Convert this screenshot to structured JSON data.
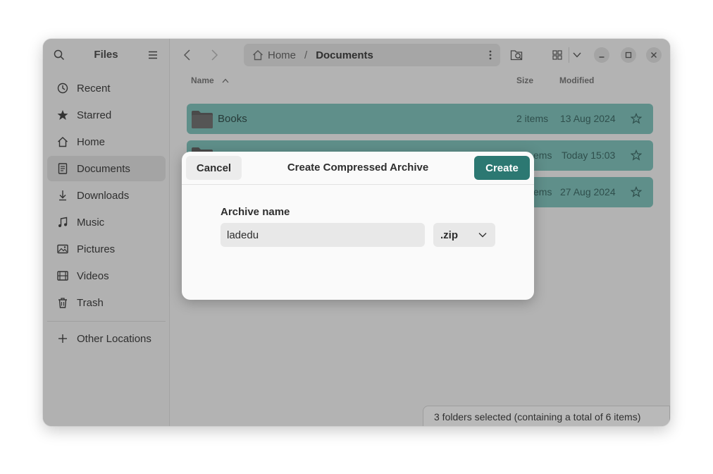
{
  "sidebar": {
    "title": "Files",
    "items": [
      {
        "label": "Recent",
        "icon": "clock-icon"
      },
      {
        "label": "Starred",
        "icon": "star-icon"
      },
      {
        "label": "Home",
        "icon": "home-icon"
      },
      {
        "label": "Documents",
        "icon": "document-icon",
        "active": true
      },
      {
        "label": "Downloads",
        "icon": "download-icon"
      },
      {
        "label": "Music",
        "icon": "music-icon"
      },
      {
        "label": "Pictures",
        "icon": "image-icon"
      },
      {
        "label": "Videos",
        "icon": "film-icon"
      },
      {
        "label": "Trash",
        "icon": "trash-icon"
      }
    ],
    "other_locations": "Other Locations"
  },
  "pathbar": {
    "home": "Home",
    "separator": "/",
    "current": "Documents"
  },
  "columns": {
    "name": "Name",
    "size": "Size",
    "modified": "Modified"
  },
  "rows": [
    {
      "name": "Books",
      "size": "2 items",
      "modified": "13 Aug 2024"
    },
    {
      "name": "",
      "size": "ems",
      "modified": "Today 15:03"
    },
    {
      "name": "",
      "size": "ems",
      "modified": "27 Aug 2024"
    }
  ],
  "statusbar": {
    "text": "3 folders selected  (containing a total of 6 items)"
  },
  "dialog": {
    "title": "Create Compressed Archive",
    "cancel_label": "Cancel",
    "create_label": "Create",
    "field_label": "Archive name",
    "archive_name": "ladedu",
    "format": ".zip"
  },
  "colors": {
    "accent": "#2c7872",
    "selection": "#5f8f8a"
  }
}
